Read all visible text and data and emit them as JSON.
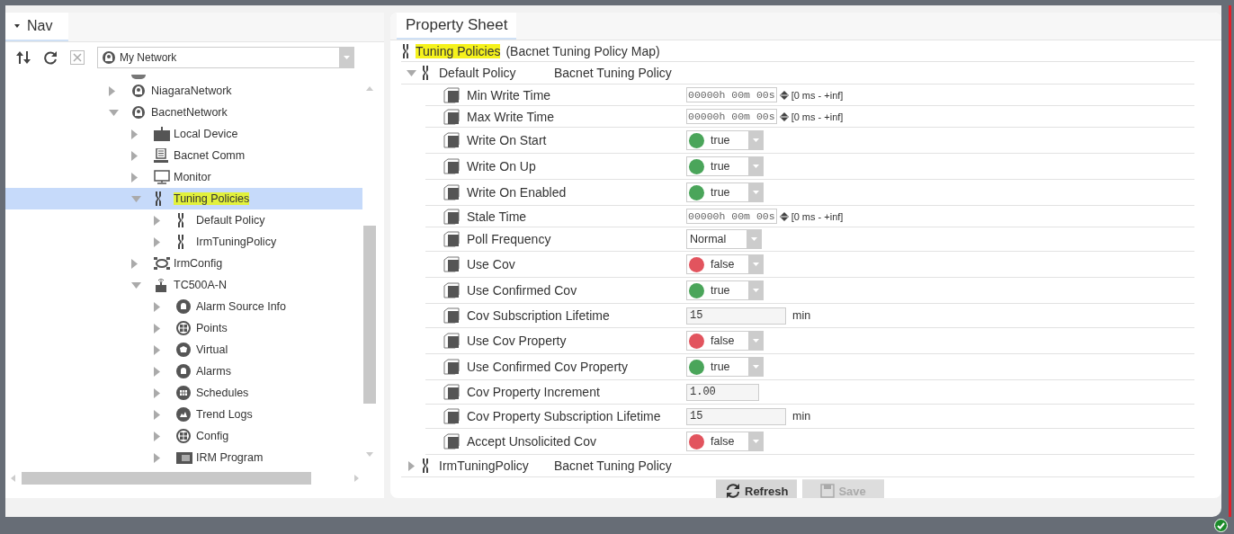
{
  "nav": {
    "tab": {
      "label": "Nav",
      "selected": true
    },
    "network": "My Network",
    "tree": [
      {
        "label": "NiagaraNetwork",
        "kind": "network",
        "expanded": false,
        "selected": false,
        "highlighted": false
      },
      {
        "label": "BacnetNetwork",
        "kind": "network",
        "expanded": true,
        "selected": false,
        "highlighted": false,
        "children": [
          {
            "label": "Local Device",
            "kind": "device",
            "expanded": false,
            "selected": false,
            "highlighted": false
          },
          {
            "label": "Bacnet Comm",
            "kind": "comm",
            "expanded": false,
            "selected": false,
            "highlighted": false
          },
          {
            "label": "Monitor",
            "kind": "monitor",
            "expanded": false,
            "selected": false,
            "highlighted": false
          },
          {
            "label": "Tuning Policies",
            "kind": "policy",
            "expanded": true,
            "selected": true,
            "highlighted": true,
            "children": [
              {
                "label": "Default Policy",
                "kind": "policy",
                "expanded": false,
                "selected": false,
                "highlighted": false
              },
              {
                "label": "IrmTuningPolicy",
                "kind": "policy",
                "expanded": false,
                "selected": false,
                "highlighted": false
              }
            ]
          },
          {
            "label": "IrmConfig",
            "kind": "config",
            "expanded": false,
            "selected": false,
            "highlighted": false
          },
          {
            "label": "TC500A-N",
            "kind": "controller",
            "expanded": true,
            "selected": false,
            "highlighted": false,
            "children": [
              {
                "label": "Alarm Source Info",
                "kind": "bell",
                "expanded": false,
                "selected": false,
                "highlighted": false
              },
              {
                "label": "Points",
                "kind": "points",
                "expanded": false,
                "selected": false,
                "highlighted": false
              },
              {
                "label": "Virtual",
                "kind": "virtual",
                "expanded": false,
                "selected": false,
                "highlighted": false
              },
              {
                "label": "Alarms",
                "kind": "bell",
                "expanded": false,
                "selected": false,
                "highlighted": false
              },
              {
                "label": "Schedules",
                "kind": "schedule",
                "expanded": false,
                "selected": false,
                "highlighted": false
              },
              {
                "label": "Trend Logs",
                "kind": "trend",
                "expanded": false,
                "selected": false,
                "highlighted": false
              },
              {
                "label": "Config",
                "kind": "points",
                "expanded": false,
                "selected": false,
                "highlighted": false
              },
              {
                "label": "IRM Program",
                "kind": "folder",
                "expanded": false,
                "selected": false,
                "highlighted": false
              }
            ]
          }
        ]
      }
    ]
  },
  "sheet": {
    "tab": {
      "label": "Property Sheet",
      "selected": true
    },
    "root": {
      "name": "Tuning Policies",
      "highlighted": true,
      "type": "(Bacnet Tuning Policy Map)"
    },
    "policies": [
      {
        "name": "Default Policy",
        "type": "Bacnet Tuning Policy",
        "expanded": true,
        "properties": [
          {
            "kind": "reltime",
            "label": "Min Write Time",
            "value": "00000h 00m 00s",
            "range": "[0 ms - +inf]"
          },
          {
            "kind": "reltime",
            "label": "Max Write Time",
            "value": "00000h 00m 00s",
            "range": "[0 ms - +inf]"
          },
          {
            "kind": "boolean",
            "label": "Write On Start",
            "value": "true",
            "on": true
          },
          {
            "kind": "boolean",
            "label": "Write On Up",
            "value": "true",
            "on": true
          },
          {
            "kind": "boolean",
            "label": "Write On Enabled",
            "value": "true",
            "on": true
          },
          {
            "kind": "reltime",
            "label": "Stale Time",
            "value": "00000h 00m 00s",
            "range": "[0 ms - +inf]"
          },
          {
            "kind": "enum",
            "label": "Poll Frequency",
            "value": "Normal"
          },
          {
            "kind": "boolean",
            "label": "Use Cov",
            "value": "false",
            "on": false
          },
          {
            "kind": "boolean",
            "label": "Use Confirmed Cov",
            "value": "true",
            "on": true
          },
          {
            "kind": "number",
            "label": "Cov Subscription Lifetime",
            "value": "15",
            "unit": "min"
          },
          {
            "kind": "boolean",
            "label": "Use Cov Property",
            "value": "false",
            "on": false
          },
          {
            "kind": "boolean",
            "label": "Use Confirmed Cov Property",
            "value": "true",
            "on": true
          },
          {
            "kind": "number",
            "label": "Cov Property Increment",
            "value": "1.00"
          },
          {
            "kind": "number",
            "label": "Cov Property Subscription Lifetime",
            "value": "15",
            "unit": "min"
          },
          {
            "kind": "boolean",
            "label": "Accept Unsolicited Cov",
            "value": "false",
            "on": false
          }
        ]
      },
      {
        "name": "IrmTuningPolicy",
        "type": "Bacnet Tuning Policy",
        "expanded": false
      }
    ],
    "buttons": [
      {
        "label": "Refresh",
        "kind": "refresh",
        "disabled": false
      },
      {
        "label": "Save",
        "kind": "save",
        "disabled": true
      }
    ]
  }
}
